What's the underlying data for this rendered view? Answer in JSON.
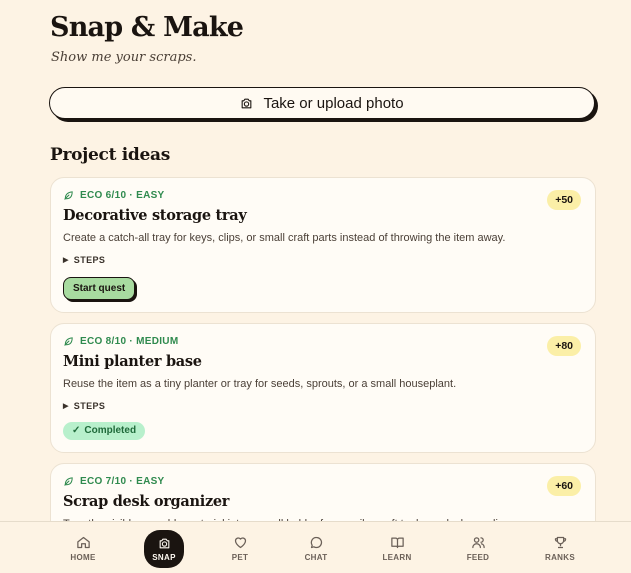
{
  "header": {
    "title": "Snap & Make",
    "tagline": "Show me your scraps."
  },
  "upload": {
    "label": "Take or upload photo",
    "icon": "camera-icon"
  },
  "ideas": {
    "section_title": "Project ideas",
    "steps_label": "STEPS",
    "cards": [
      {
        "meta": "ECO 6/10 · EASY",
        "points": "+50",
        "title": "Decorative storage tray",
        "desc": "Create a catch-all tray for keys, clips, or small craft parts instead of throwing the item away.",
        "action": "Start quest",
        "status": "open"
      },
      {
        "meta": "ECO 8/10 · MEDIUM",
        "points": "+80",
        "title": "Mini planter base",
        "desc": "Reuse the item as a tiny planter or tray for seeds, sprouts, or a small houseplant.",
        "action": "Completed",
        "status": "completed"
      },
      {
        "meta": "ECO 7/10 · EASY",
        "points": "+60",
        "title": "Scrap desk organizer",
        "desc": "Turn the visible reusable material into a small holder for pencils, craft tools, or desk supplies.",
        "status": "open"
      }
    ]
  },
  "tabs": [
    {
      "label": "HOME",
      "icon": "home-icon"
    },
    {
      "label": "SNAP",
      "icon": "camera-icon",
      "active": true
    },
    {
      "label": "PET",
      "icon": "heart-icon"
    },
    {
      "label": "CHAT",
      "icon": "chat-bubble-icon"
    },
    {
      "label": "LEARN",
      "icon": "book-icon"
    },
    {
      "label": "FEED",
      "icon": "users-icon"
    },
    {
      "label": "RANKS",
      "icon": "trophy-icon"
    }
  ],
  "colors": {
    "background": "#fdf3e4",
    "eco_green": "#2f8a4e",
    "points_badge": "#fbefa7",
    "start_button": "#a8dba0",
    "completed_badge": "#b8f0cc",
    "ink": "#1a1410"
  }
}
